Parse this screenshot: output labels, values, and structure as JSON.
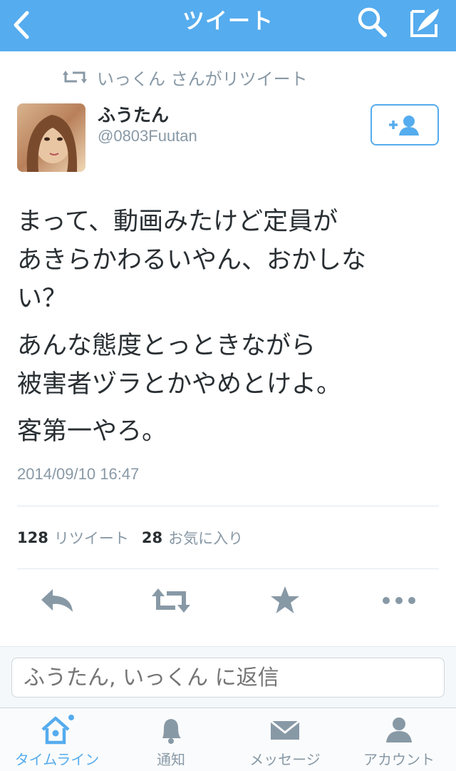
{
  "navbar": {
    "title": "ツイート"
  },
  "retweet_context": {
    "text": "いっくん さんがリツイート"
  },
  "user": {
    "name": "ふうたん",
    "handle": "@0803Fuutan"
  },
  "tweet": {
    "paragraphs": [
      "まって、動画みたけど定員が\nあきらかわるいやん、おかしな\nい？",
      "あんな態度とっときながら\n被害者ヅラとかやめとけよ。",
      "客第一やろ。"
    ],
    "timestamp": "2014/09/10 16:47"
  },
  "stats": {
    "retweets_count": "128",
    "retweets_label": "リツイート",
    "favorites_count": "28",
    "favorites_label": "お気に入り"
  },
  "actions": [
    "reply-icon",
    "retweet-icon",
    "favorite-star-icon",
    "more-dots-icon"
  ],
  "reply": {
    "placeholder": "ふうたん, いっくん に返信"
  },
  "tabs": [
    {
      "label": "タイムライン",
      "icon": "home-icon",
      "active": true
    },
    {
      "label": "通知",
      "icon": "bell-icon",
      "active": false
    },
    {
      "label": "メッセージ",
      "icon": "envelope-icon",
      "active": false
    },
    {
      "label": "アカウント",
      "icon": "person-icon",
      "active": false
    }
  ],
  "colors": {
    "brand": "#55acee",
    "text": "#292f33",
    "muted": "#8899a6"
  }
}
